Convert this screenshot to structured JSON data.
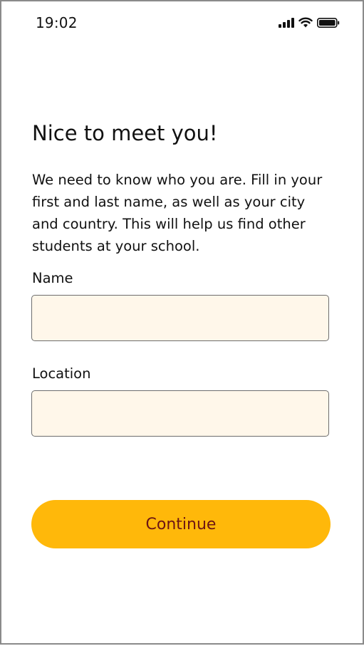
{
  "status_bar": {
    "time": "19:02",
    "icons": [
      "cellular-signal-icon",
      "wifi-icon",
      "battery-icon"
    ]
  },
  "onboarding": {
    "title": "Nice to meet you!",
    "description": "We need to know who you are. Fill in your first and last name, as well as your city and country. This will help us find other students at your school.",
    "name_label": "Name",
    "name_value": "",
    "location_label": "Location",
    "location_value": "",
    "continue_label": "Continue"
  },
  "colors": {
    "field_background": "#fff7ea",
    "button_background": "#ffb80a",
    "button_text": "#6b1414"
  }
}
